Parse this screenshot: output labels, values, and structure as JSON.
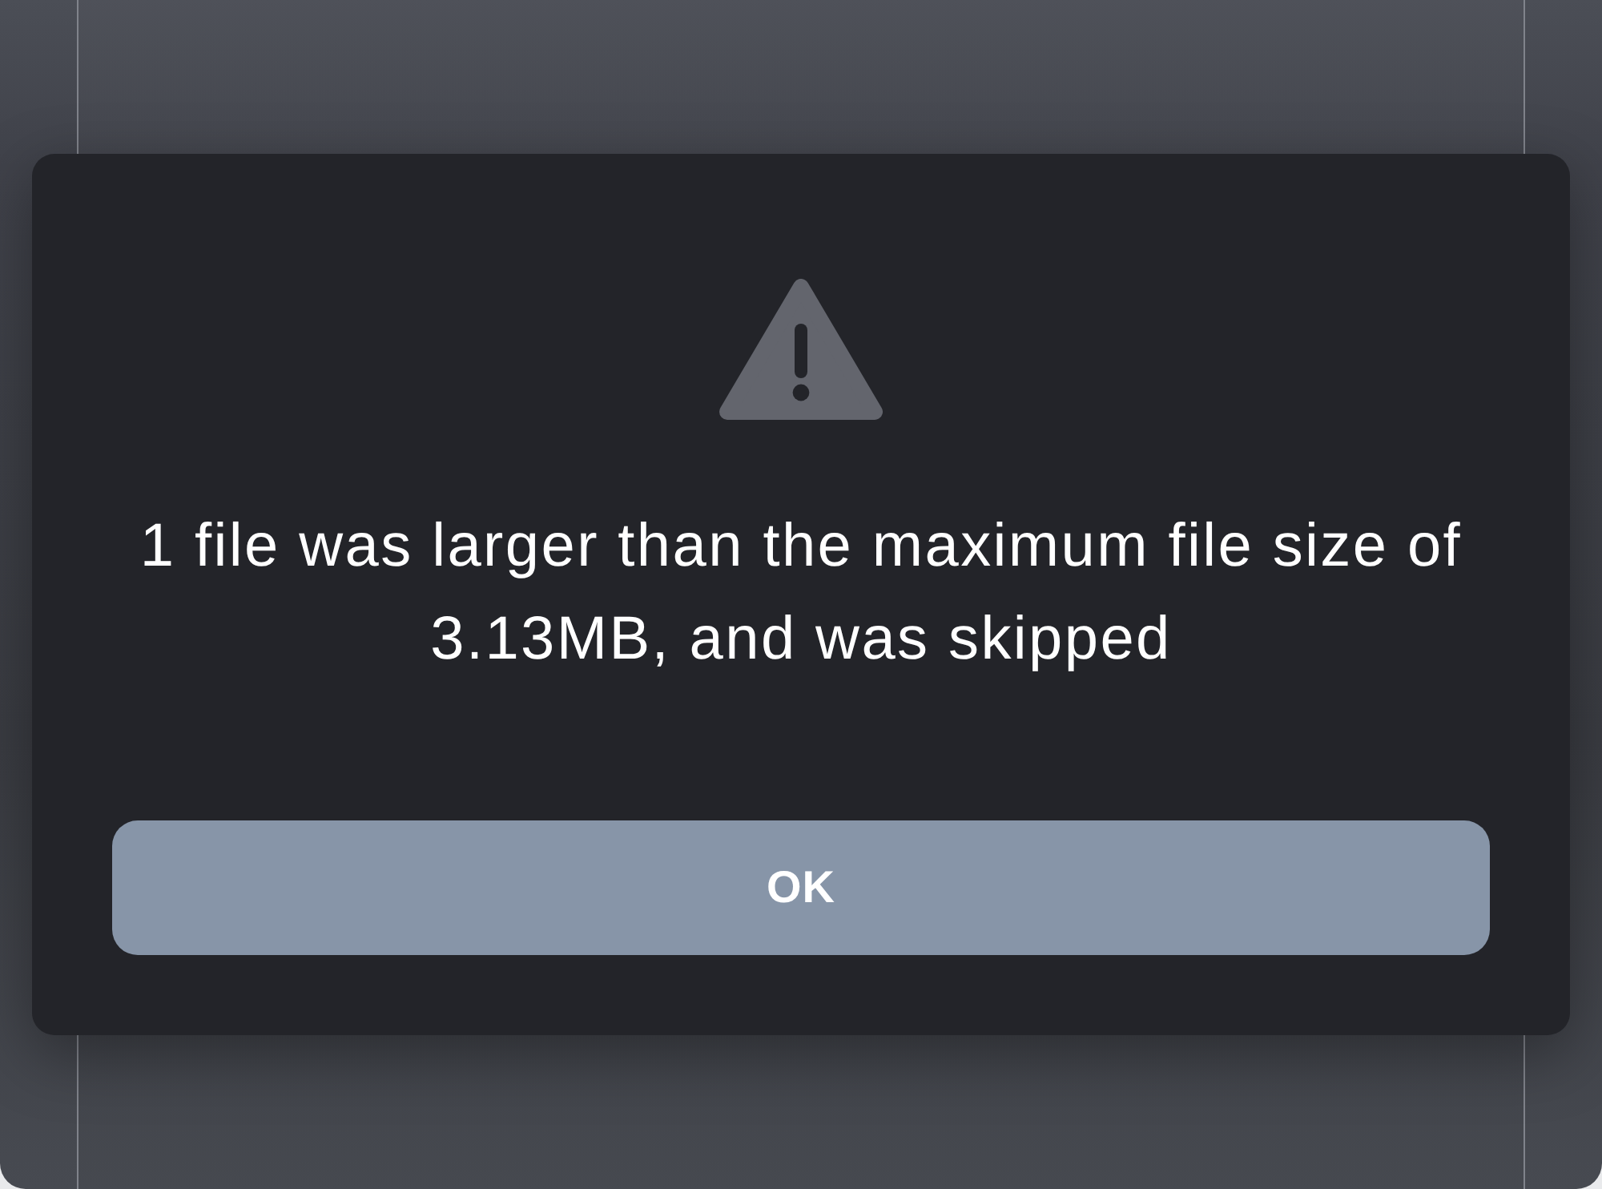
{
  "alert_dialog": {
    "message": "1 file was larger than the maximum file size of 3.13MB, and was skipped",
    "button": {
      "label": "OK"
    }
  }
}
